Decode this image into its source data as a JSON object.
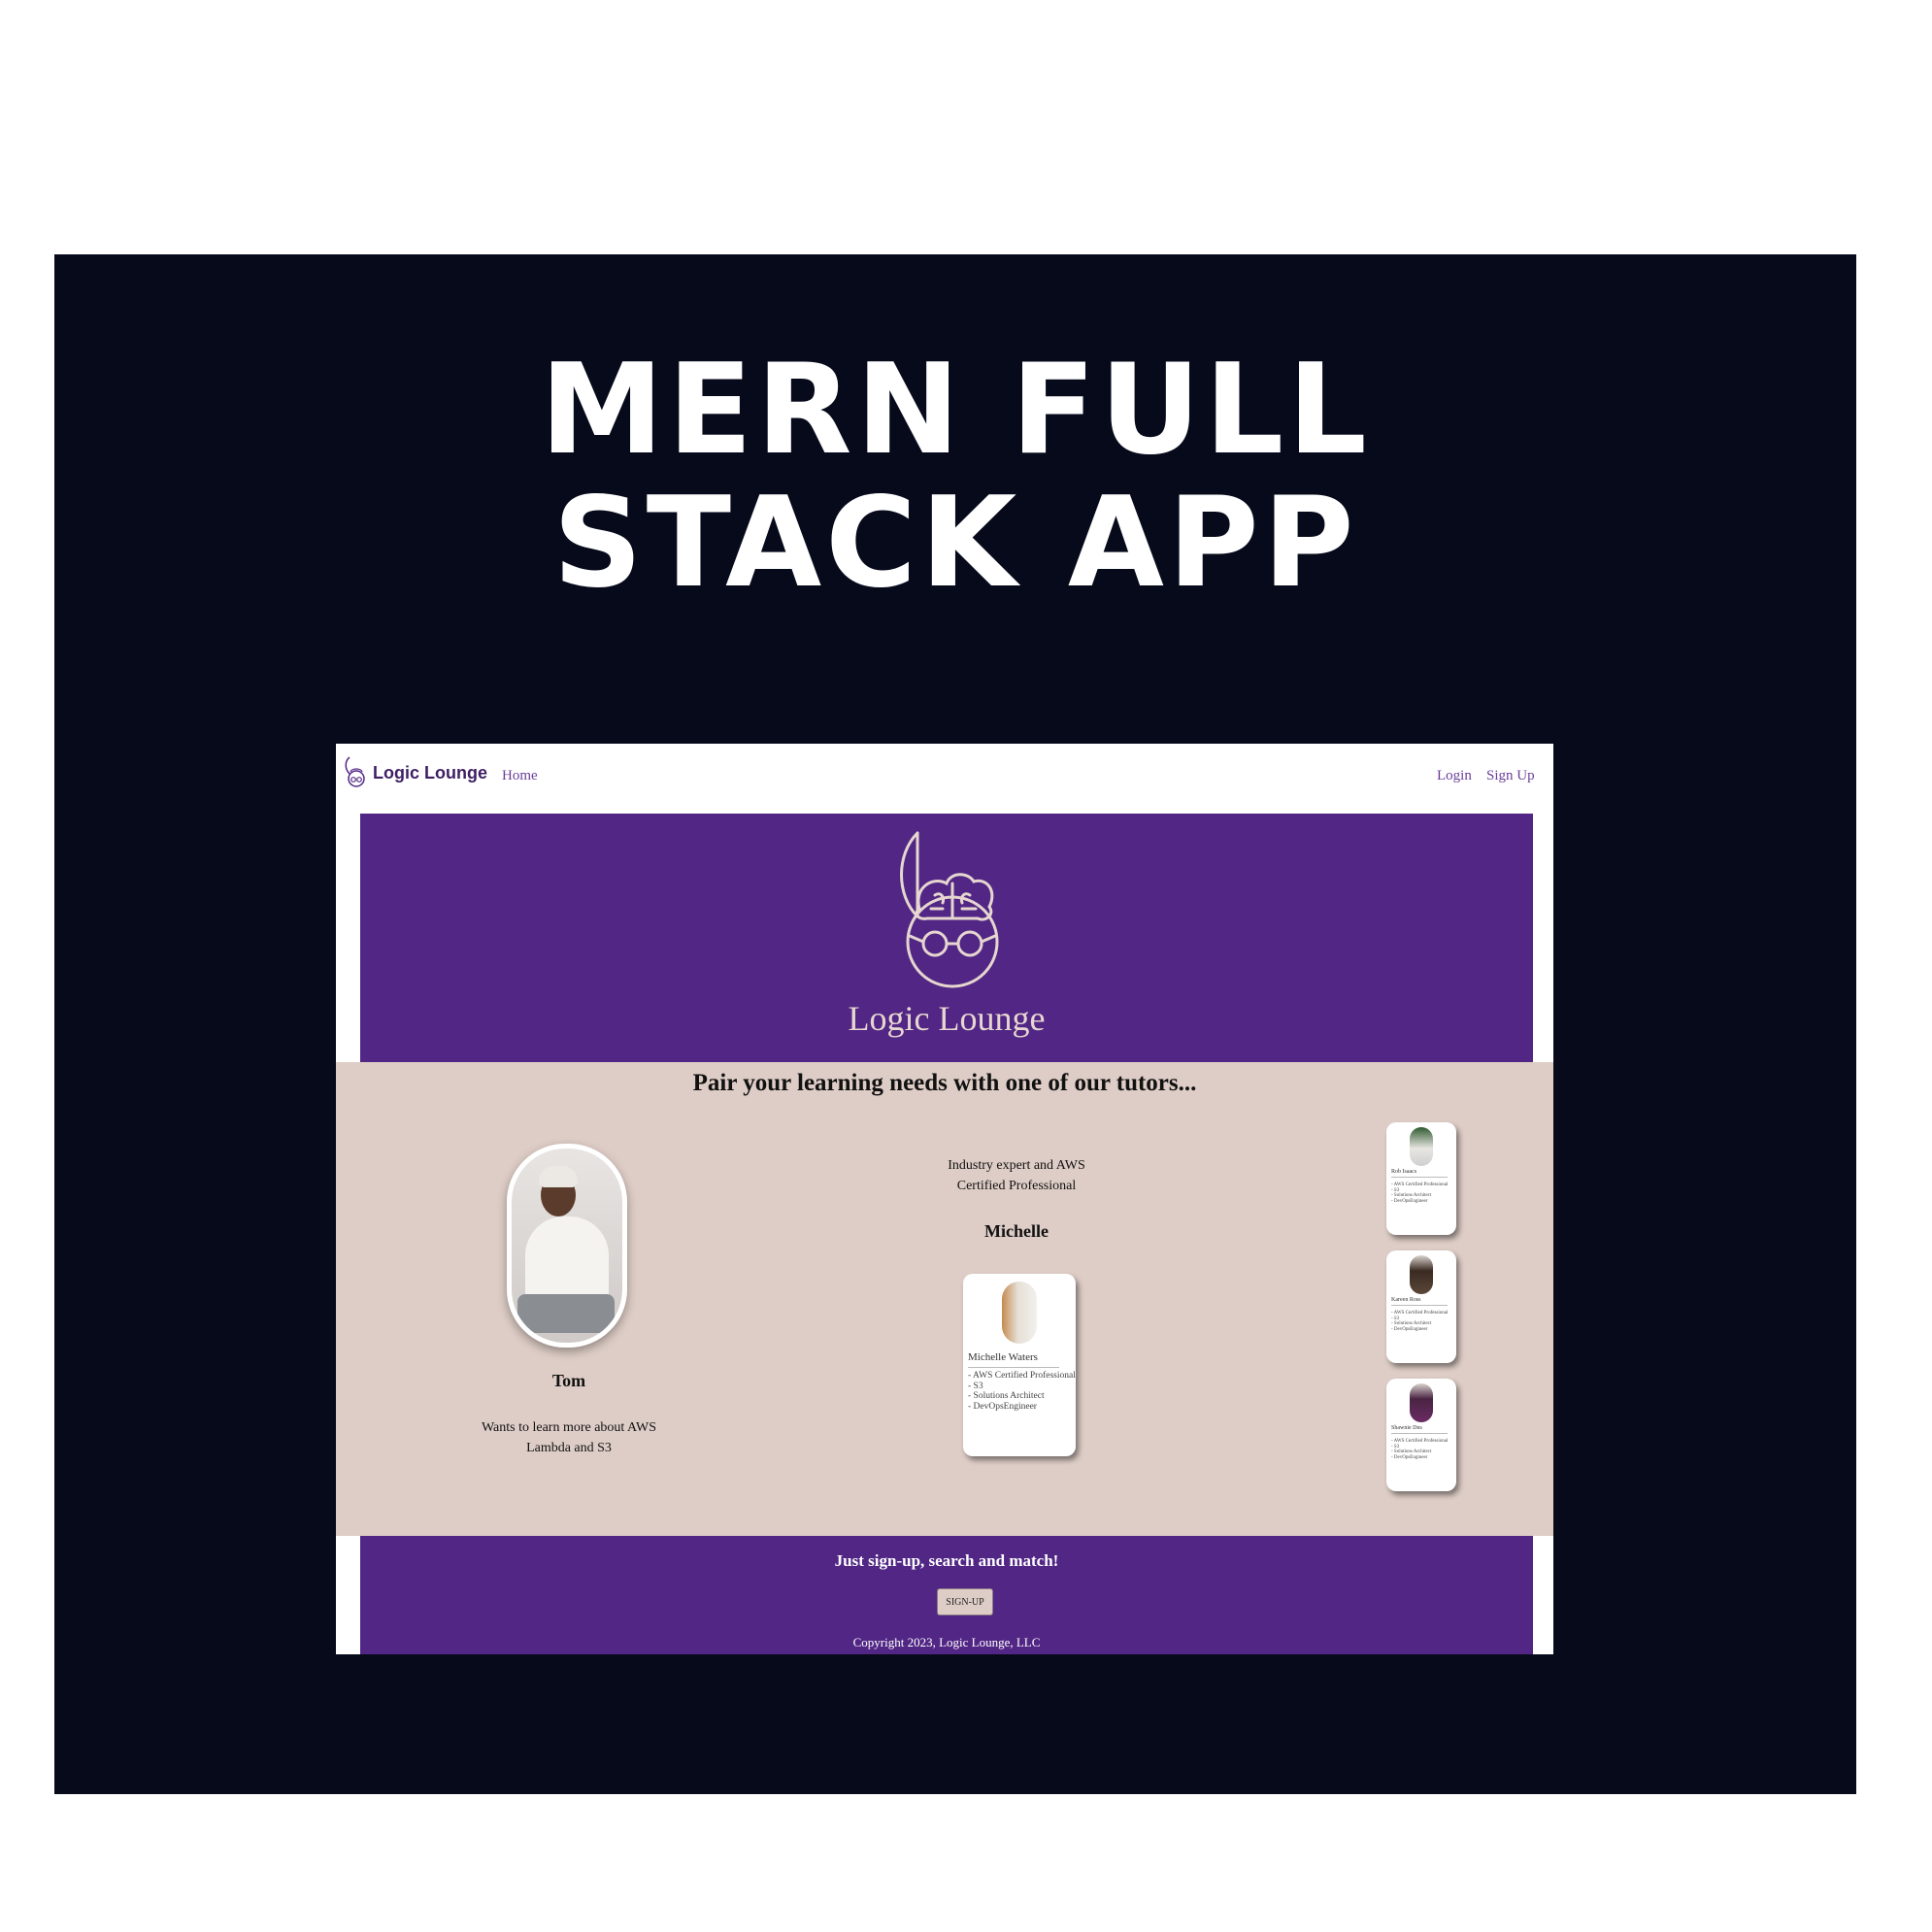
{
  "headline": {
    "line1": "MERN FULL",
    "line2": "STACK APP"
  },
  "nav": {
    "brand": "Logic Lounge",
    "home": "Home",
    "login": "Login",
    "signup": "Sign Up"
  },
  "hero": {
    "title": "Logic Lounge"
  },
  "band": {
    "heading": "Pair your learning needs with one of our tutors..."
  },
  "student": {
    "name": "Tom",
    "description": "Wants to learn more about AWS Lambda and S3"
  },
  "featured": {
    "description": "Industry expert and AWS Certified Professional",
    "name": "Michelle"
  },
  "featured_card": {
    "name": "Michelle Waters",
    "skills": [
      "- AWS Certified Professional",
      "- S3",
      "- Solutions Architect",
      "- DevOpsEngineer"
    ]
  },
  "tutor_cards": [
    {
      "name": "Rob Isaacs",
      "skills": [
        "- AWS Certified Professional",
        "- S3",
        "- Solutions Architect",
        "- DevOpsEngineer"
      ]
    },
    {
      "name": "Kareen Ross",
      "skills": [
        "- AWS Certified Professional",
        "- S3",
        "- Solutions Architect",
        "- DevOpsEngineer"
      ]
    },
    {
      "name": "Shawnie Dns",
      "skills": [
        "- AWS Certified Professional",
        "- S3",
        "- Solutions Architect",
        "- DevOpsEngineer"
      ]
    }
  ],
  "footer": {
    "tagline": "Just sign-up, search and match!",
    "button": "SIGN-UP",
    "copyright": "Copyright 2023, Logic Lounge, LLC"
  },
  "colors": {
    "poster_bg": "#060a1b",
    "brand_purple": "#512685",
    "band_beige": "#decdc6",
    "logo_line": "#e6d6d0"
  }
}
